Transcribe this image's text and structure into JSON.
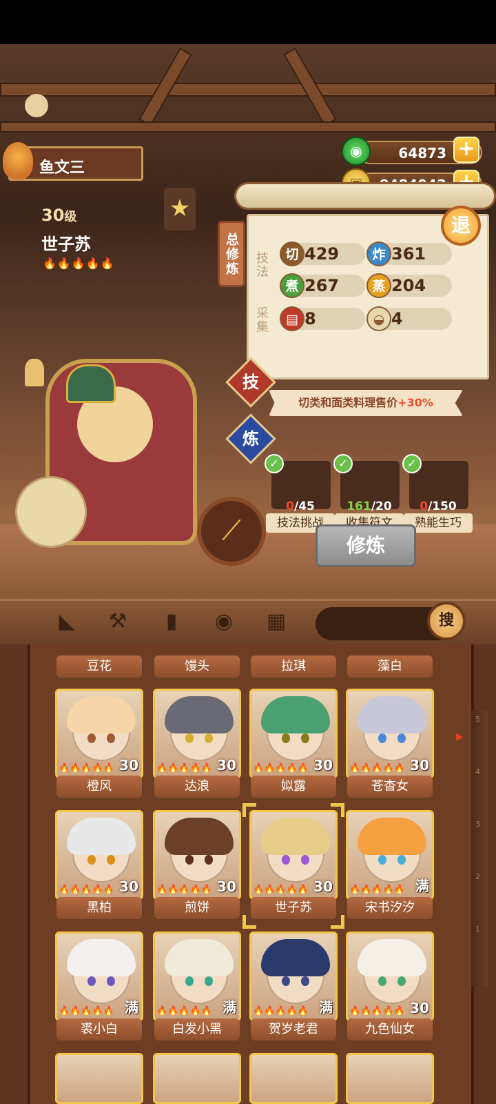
{
  "player": {
    "name": "鱼文三"
  },
  "character": {
    "level": "30",
    "level_unit": "级",
    "name": "世子苏",
    "flames": "🔥🔥🔥🔥🔥"
  },
  "currency": {
    "jade": "64873",
    "coins": "8484042"
  },
  "exit_label": "退",
  "panel": {
    "tab_label": "总修炼",
    "group_technique": "技法",
    "group_collect": "采集",
    "skills": [
      {
        "icon": "切",
        "value": "429",
        "color": "#8a5a2a"
      },
      {
        "icon": "炸",
        "value": "361",
        "color": "#3a8ac8"
      },
      {
        "icon": "煮",
        "value": "267",
        "color": "#4aa040"
      },
      {
        "icon": "蒸",
        "value": "204",
        "color": "#e8a020"
      }
    ],
    "collect": [
      {
        "icon": "meat-icon",
        "value": "8"
      },
      {
        "icon": "flour-icon",
        "value": "4"
      }
    ]
  },
  "side_buttons": {
    "skill": "技",
    "train": "炼"
  },
  "bonus": {
    "text": "切类和面类料理售价",
    "highlight": "+30%"
  },
  "tasks": [
    {
      "done": "0",
      "total": "/45",
      "label": "技法挑战",
      "done_color": "#f04a2a"
    },
    {
      "done": "161",
      "total": "/20",
      "label": "收集符文",
      "done_color": "#8ad04a"
    },
    {
      "done": "0",
      "total": "/150",
      "label": "熟能生巧",
      "done_color": "#f04a2a"
    }
  ],
  "train_button": "修炼",
  "toolbar": {
    "search_label": "搜",
    "icons": [
      "leg-icon",
      "shovel-icon",
      "jar-icon",
      "location-icon",
      "map-icon"
    ]
  },
  "top_row": [
    "豆花",
    "馒头",
    "拉琪",
    "藻白"
  ],
  "rows": [
    [
      {
        "name": "橙风",
        "level": "30",
        "hair": "#f6d6a8",
        "eye": "#a05a30"
      },
      {
        "name": "达浪",
        "level": "30",
        "hair": "#6a6a74",
        "eye": "#d8b030"
      },
      {
        "name": "姒露",
        "level": "30",
        "hair": "#4aa070",
        "eye": "#8a7a20"
      },
      {
        "name": "苍杳女",
        "level": "30",
        "hair": "#c8c8d8",
        "eye": "#4a8ad8"
      }
    ],
    [
      {
        "name": "黑柏",
        "level": "30",
        "hair": "#e8e8e8",
        "eye": "#d8901a"
      },
      {
        "name": "煎饼",
        "level": "30",
        "hair": "#6a4028",
        "eye": "#5a3020"
      },
      {
        "name": "世子苏",
        "level": "30",
        "hair": "#e8cc8a",
        "eye": "#9a5ad0"
      },
      {
        "name": "宋书汐汐",
        "level": "满",
        "hair": "#f4a040",
        "eye": "#4ab0d8"
      }
    ],
    [
      {
        "name": "裘小白",
        "level": "满",
        "hair": "#f4f0f0",
        "eye": "#6a5ac0"
      },
      {
        "name": "白发小黑",
        "level": "满",
        "hair": "#f0ead8",
        "eye": "#3aa890"
      },
      {
        "name": "贺岁老君",
        "level": "满",
        "hair": "#2a3a6a",
        "eye": "#3a4a8a"
      },
      {
        "name": "九色仙女",
        "level": "30",
        "hair": "#f4f0e8",
        "eye": "#4aa870"
      }
    ]
  ],
  "ruler_ticks": [
    "5",
    "4",
    "3",
    "2",
    "1"
  ]
}
